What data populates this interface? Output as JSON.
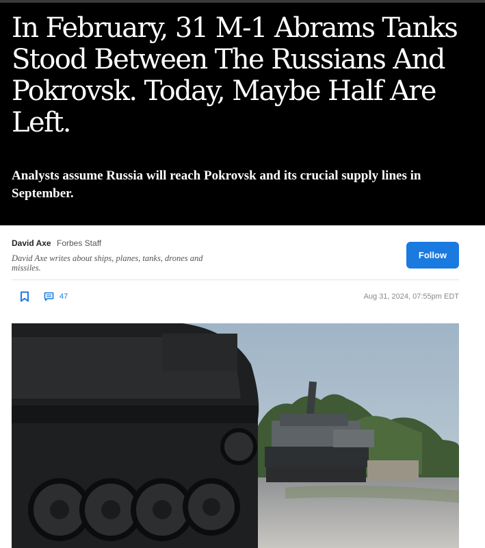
{
  "article": {
    "headline": "In February, 31 M-1 Abrams Tanks Stood Between The Russians And Pokrovsk. Today, Maybe Half Are Left.",
    "subheadline": "Analysts assume Russia will reach Pokrovsk and its crucial supply lines in September."
  },
  "author": {
    "name": "David Axe",
    "role": "Forbes Staff",
    "bio": "David Axe writes about ships, planes, tanks, drones and missiles.",
    "follow_label": "Follow"
  },
  "toolbar": {
    "comment_count": "47",
    "timestamp": "Aug 31, 2024, 07:55pm EDT"
  },
  "icons": {
    "bookmark": "bookmark-icon",
    "comment": "comment-icon"
  },
  "colors": {
    "accent": "#1a7ae0",
    "hero_background": "#000000"
  }
}
